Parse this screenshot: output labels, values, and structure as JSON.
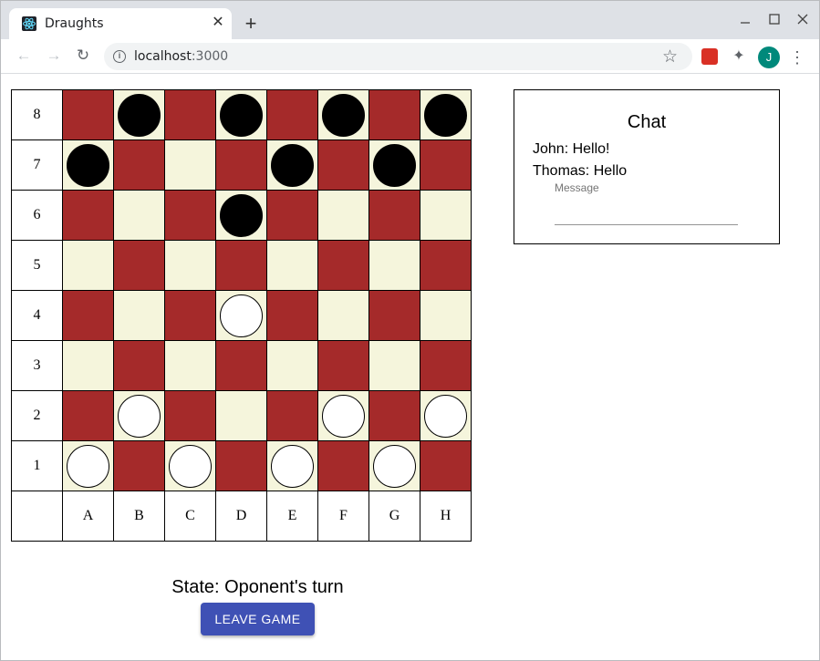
{
  "browser": {
    "tab_title": "Draughts",
    "url_host": "localhost",
    "url_port": ":3000",
    "avatar_letter": "J"
  },
  "board": {
    "row_labels": [
      "8",
      "7",
      "6",
      "5",
      "4",
      "3",
      "2",
      "1"
    ],
    "col_labels": [
      "A",
      "B",
      "C",
      "D",
      "E",
      "F",
      "G",
      "H"
    ],
    "rows": [
      [
        "",
        "b",
        "",
        "b",
        "",
        "b",
        "",
        "b"
      ],
      [
        "b",
        "",
        "",
        "",
        "b",
        "",
        "b",
        ""
      ],
      [
        "",
        "",
        "",
        "b",
        "",
        "",
        "",
        ""
      ],
      [
        "",
        "",
        "",
        "",
        "",
        "",
        "",
        ""
      ],
      [
        "",
        "",
        "",
        "w",
        "",
        "",
        "",
        ""
      ],
      [
        "",
        "",
        "",
        "",
        "",
        "",
        "",
        ""
      ],
      [
        "",
        "w",
        "",
        "",
        "",
        "w",
        "",
        "w"
      ],
      [
        "w",
        "",
        "w",
        "",
        "w",
        "",
        "w",
        ""
      ]
    ],
    "colors": {
      "dark": "#a52a2a",
      "light": "#f5f5dc"
    }
  },
  "chat": {
    "title": "Chat",
    "messages": [
      "John: Hello!",
      "Thomas: Hello"
    ],
    "input_label": "Message",
    "input_value": ""
  },
  "state_text": "State: Oponent's turn",
  "leave_button_label": "Leave game",
  "accent_color": "#3f51b5"
}
